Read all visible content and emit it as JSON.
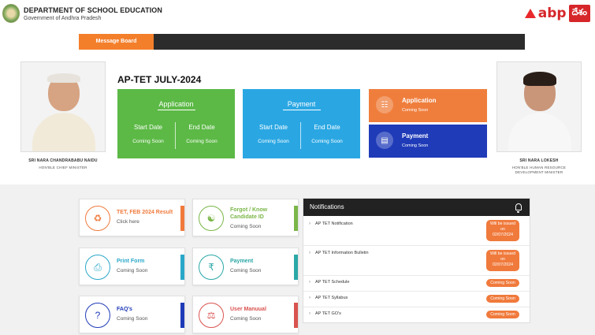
{
  "header": {
    "dept_title": "DEPARTMENT OF SCHOOL EDUCATION",
    "dept_subtitle": "Government of Andhra Pradesh",
    "brand_text": "abp",
    "brand_box": "దేశం"
  },
  "message_board": {
    "label": "Message Board"
  },
  "leaders": [
    {
      "name": "SRI NARA CHANDRABABU NAIDU",
      "role": "HON'BLE CHIEF MINISTER"
    },
    {
      "name": "SRI NARA LOKESH",
      "role_line1": "HON'BLE HUMAN RESOURCE",
      "role_line2": "DEVELOPMENT MINISTER"
    }
  ],
  "exam": {
    "title": "AP-TET JULY-2024"
  },
  "big_tiles": [
    {
      "title": "Application",
      "start_label": "Start Date",
      "start_value": "Coming Soon",
      "end_label": "End Date",
      "end_value": "Coming Soon",
      "color": "#5cb946"
    },
    {
      "title": "Payment",
      "start_label": "Start Date",
      "start_value": "Coming Soon",
      "end_label": "End Date",
      "end_value": "Coming Soon",
      "color": "#2aa7e3"
    }
  ],
  "side_tiles": [
    {
      "title": "Application",
      "value": "Coming Soon",
      "icon": "document-icon",
      "color": "#ef7e3d"
    },
    {
      "title": "Payment",
      "value": "Coming Soon",
      "icon": "wallet-icon",
      "color": "#1f3bb8"
    }
  ],
  "cards": [
    {
      "title": "TET, FEB 2024 Result",
      "value": "Click here",
      "icon": "result-icon",
      "color": "#f07a3c"
    },
    {
      "title_line1": "Forgot / Know",
      "title_line2": "Candidate ID",
      "value": "Coming Soon",
      "icon": "user-id-icon",
      "color": "#7ab648"
    },
    {
      "title": "Print Form",
      "value": "Coming Soon",
      "icon": "printer-icon",
      "color": "#2aa7c9"
    },
    {
      "title": "Payment",
      "value": "Coming Soon",
      "icon": "payment-icon",
      "color": "#2aa7a7"
    },
    {
      "title": "FAQ's",
      "value": "Coming Soon",
      "icon": "question-icon",
      "color": "#1f3bb8"
    },
    {
      "title": "User Manuual",
      "value": "Coming Soon",
      "icon": "manual-icon",
      "color": "#d9534f"
    }
  ],
  "notifications": {
    "title": "Notifications",
    "items": [
      {
        "label": "AP TET Notification",
        "badge_line1": "Will be issued",
        "badge_line2": "on",
        "badge_line3": "02/07/2024"
      },
      {
        "label": "AP TET Information Bulletin",
        "badge_line1": "Will be issued",
        "badge_line2": "on",
        "badge_line3": "02/07/2024"
      },
      {
        "label": "AP TET Schedule",
        "badge": "Coming Soon"
      },
      {
        "label": "AP TET Syllabus",
        "badge": "Coming Soon"
      },
      {
        "label": "AP TET GO's",
        "badge": "Coming Soon"
      }
    ]
  }
}
